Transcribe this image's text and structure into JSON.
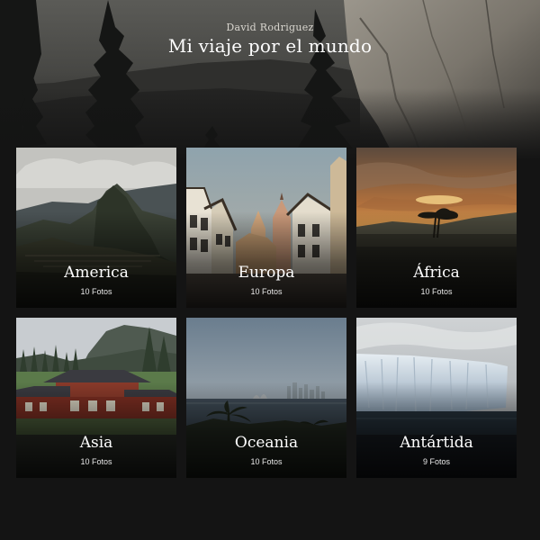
{
  "hero": {
    "author": "David Rodriguez",
    "title": "Mi viaje por el mundo"
  },
  "gallery": {
    "albums": [
      {
        "name": "America",
        "count": "10 Fotos"
      },
      {
        "name": "Europa",
        "count": "10 Fotos"
      },
      {
        "name": "África",
        "count": "10 Fotos"
      },
      {
        "name": "Asia",
        "count": "10 Fotos"
      },
      {
        "name": "Oceania",
        "count": "10 Fotos"
      },
      {
        "name": "Antártida",
        "count": "9 Fotos"
      }
    ]
  }
}
